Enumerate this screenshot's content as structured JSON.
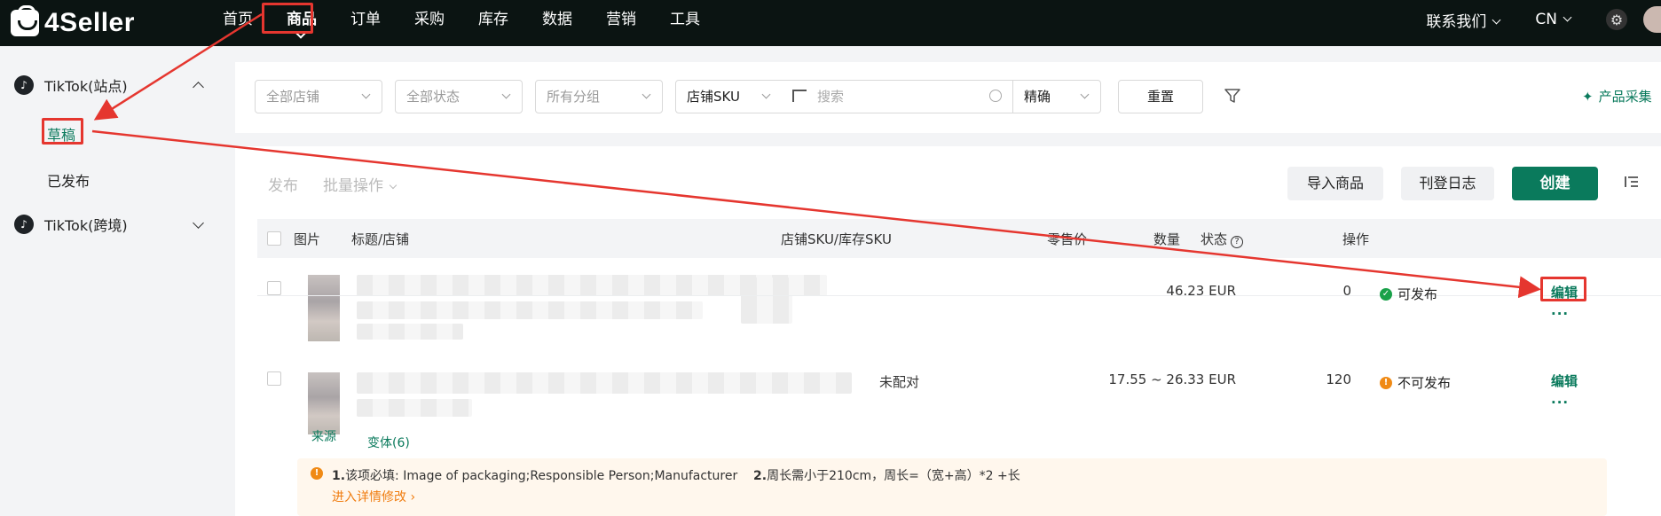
{
  "app": {
    "logo": "4Seller"
  },
  "nav": {
    "items": [
      "首页",
      "商品",
      "订单",
      "采购",
      "库存",
      "数据",
      "营销",
      "工具"
    ],
    "active_index": 1,
    "contact": "联系我们",
    "language": "CN"
  },
  "sidebar": {
    "groups": [
      {
        "label": "TikTok(站点)",
        "expanded": true,
        "items": [
          "草稿",
          "已发布"
        ],
        "active_item": 0
      },
      {
        "label": "TikTok(跨境)",
        "expanded": false
      }
    ]
  },
  "filters": {
    "store": "全部店铺",
    "status": "全部状态",
    "group": "所有分组",
    "search_field": "店铺SKU",
    "search_placeholder": "搜索",
    "match_mode": "精确",
    "reset": "重置",
    "collect": "产品采集"
  },
  "actions": {
    "publish": "发布",
    "batch": "批量操作",
    "import": "导入商品",
    "log": "刊登日志",
    "create": "创建"
  },
  "table": {
    "headers": {
      "image": "图片",
      "title": "标题/店铺",
      "sku": "店铺SKU/库存SKU",
      "price": "零售价",
      "qty": "数量",
      "status": "状态",
      "ops": "操作"
    },
    "rows": [
      {
        "sku": "",
        "price": "46.23 EUR",
        "qty": "0",
        "status": "可发布",
        "status_type": "ok",
        "edit": "编辑",
        "more": "..."
      },
      {
        "sku": "未配对",
        "price": "17.55 ~ 26.33 EUR",
        "qty": "120",
        "status": "不可发布",
        "status_type": "warn",
        "edit": "编辑",
        "more": "...",
        "source": "来源",
        "variants": "变体(6)"
      }
    ],
    "warning": {
      "num1": "1.",
      "text1": "该项必填: Image of packaging;Responsible Person;Manufacturer",
      "num2": "2.",
      "text2": "周长需小于210cm，周长=（宽+高）*2 +长",
      "link": "进入详情修改"
    }
  },
  "colors": {
    "brand": "#0a7a5c",
    "annotation": "#e5362f",
    "warning": "#f08a15"
  }
}
